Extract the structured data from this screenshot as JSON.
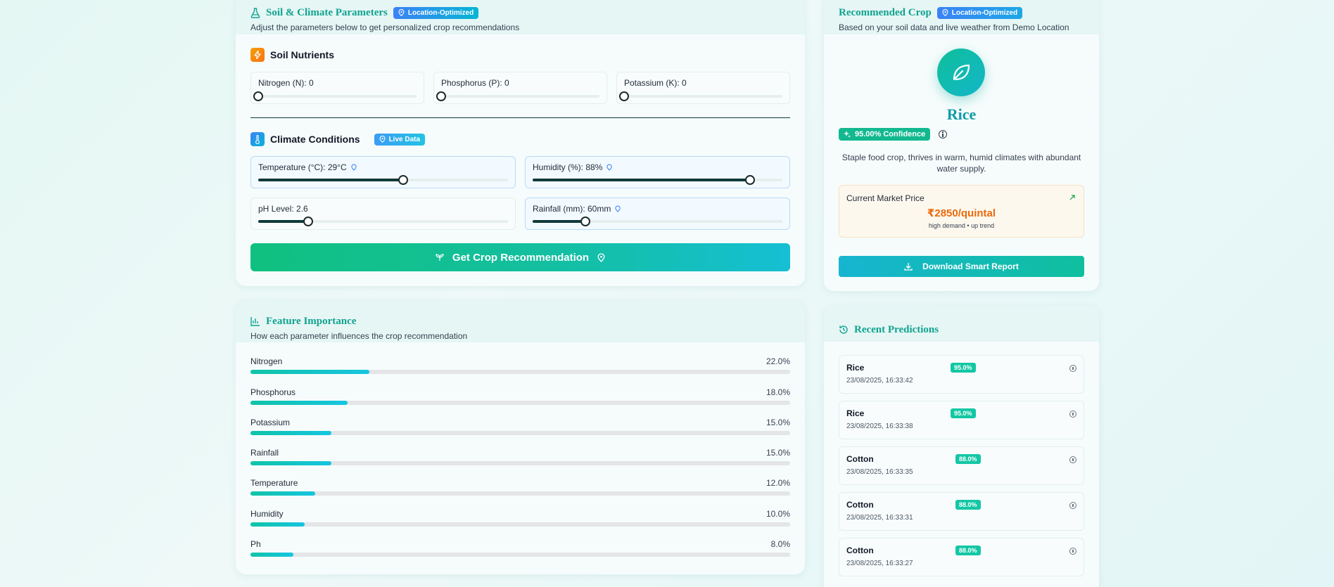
{
  "params": {
    "title": "Soil & Climate Parameters",
    "badge": "Location-Optimized",
    "subtitle": "Adjust the parameters below to get personalized crop recommendations",
    "nutrients_title": "Soil Nutrients",
    "nitrogen": {
      "label": "Nitrogen (N): 0",
      "level": 0
    },
    "phosphorus": {
      "label": "Phosphorus (P): 0",
      "level": 0
    },
    "potassium": {
      "label": "Potassium (K): 0",
      "level": 0
    },
    "climate_title": "Climate Conditions",
    "live_badge": "Live Data",
    "temperature": {
      "label": "Temperature (°C): 29°C",
      "level": 0.58
    },
    "humidity": {
      "label": "Humidity (%): 88%",
      "level": 0.87
    },
    "ph": {
      "label": "pH Level: 2.6",
      "level": 0.2
    },
    "rainfall": {
      "label": "Rainfall (mm): 60mm",
      "level": 0.21
    },
    "button": "Get Crop Recommendation"
  },
  "feature_importance": {
    "title": "Feature Importance",
    "subtitle": "How each parameter influences the crop recommendation",
    "items": [
      {
        "name": "Nitrogen",
        "pct": "22.0%",
        "value": 0.22
      },
      {
        "name": "Phosphorus",
        "pct": "18.0%",
        "value": 0.18
      },
      {
        "name": "Potassium",
        "pct": "15.0%",
        "value": 0.15
      },
      {
        "name": "Rainfall",
        "pct": "15.0%",
        "value": 0.15
      },
      {
        "name": "Temperature",
        "pct": "12.0%",
        "value": 0.12
      },
      {
        "name": "Humidity",
        "pct": "10.0%",
        "value": 0.1
      },
      {
        "name": "Ph",
        "pct": "8.0%",
        "value": 0.08
      }
    ]
  },
  "recommendation": {
    "title": "Recommended Crop",
    "badge": "Location-Optimized",
    "subtitle": "Based on your soil data and live weather from Demo Location",
    "crop": "Rice",
    "confidence": "95.00% Confidence",
    "description": "Staple food crop, thrives in warm, humid climates with abundant water supply.",
    "market_label": "Current Market Price",
    "price": "₹2850/quintal",
    "price_note": "high demand • up trend",
    "download": "Download Smart Report"
  },
  "recent": {
    "title": "Recent Predictions",
    "items": [
      {
        "crop": "Rice",
        "time": "23/08/2025, 16:33:42",
        "conf": "95.0%"
      },
      {
        "crop": "Rice",
        "time": "23/08/2025, 16:33:38",
        "conf": "95.0%"
      },
      {
        "crop": "Cotton",
        "time": "23/08/2025, 16:33:35",
        "conf": "88.0%"
      },
      {
        "crop": "Cotton",
        "time": "23/08/2025, 16:33:31",
        "conf": "88.0%"
      },
      {
        "crop": "Cotton",
        "time": "23/08/2025, 16:33:27",
        "conf": "88.0%"
      }
    ]
  },
  "colors": {
    "accent": "#10a38f",
    "brand_gradient_start": "#10c48f",
    "brand_gradient_end": "#14bfd6",
    "price": "#ea6a0c"
  }
}
